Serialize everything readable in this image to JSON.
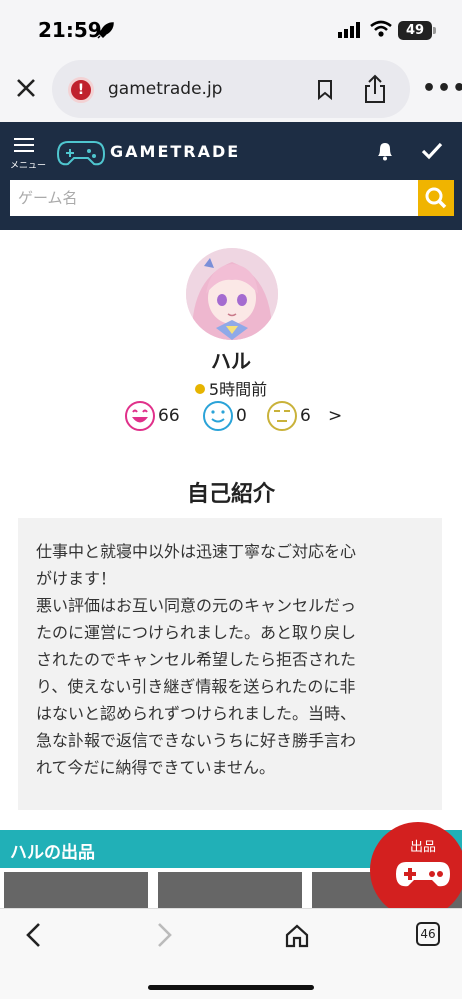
{
  "status_bar": {
    "time": "21:59",
    "battery": "49"
  },
  "browser": {
    "url": "gametrade.jp",
    "tab_count": "46"
  },
  "site_header": {
    "menu_label": "メニュー",
    "logo_text": "GAMETRADE",
    "search_placeholder": "ゲーム名"
  },
  "profile": {
    "name": "ハル",
    "last_login": "5時間前",
    "ratings": [
      {
        "type": "good",
        "count": "66",
        "color": "#e0308a"
      },
      {
        "type": "normal",
        "count": "0",
        "color": "#2aa3d8"
      },
      {
        "type": "bad",
        "count": "6",
        "color": "#c9b23a"
      }
    ],
    "ratings_more": ">"
  },
  "intro": {
    "title": "自己紹介",
    "lines": [
      "仕事中と就寝中以外は迅速丁寧なご対応を心",
      "がけます！",
      "悪い評価はお互い同意の元のキャンセルだっ",
      "たのに運営につけられました。あと取り戻し",
      "されたのでキャンセル希望したら拒否された",
      "り、使えない引き継ぎ情報を送られたのに非",
      "はないと認められずつけられました。当時、",
      "急な訃報で返信できないうちに好き勝手言わ",
      "れて今だに納得できていません。"
    ]
  },
  "listings": {
    "title": "ハルの出品"
  },
  "fab": {
    "label": "出品"
  },
  "colors": {
    "header_bg": "#1d2d44",
    "search_btn": "#f0b400",
    "listings_bar": "#21b0b7",
    "fab": "#d3201f"
  }
}
